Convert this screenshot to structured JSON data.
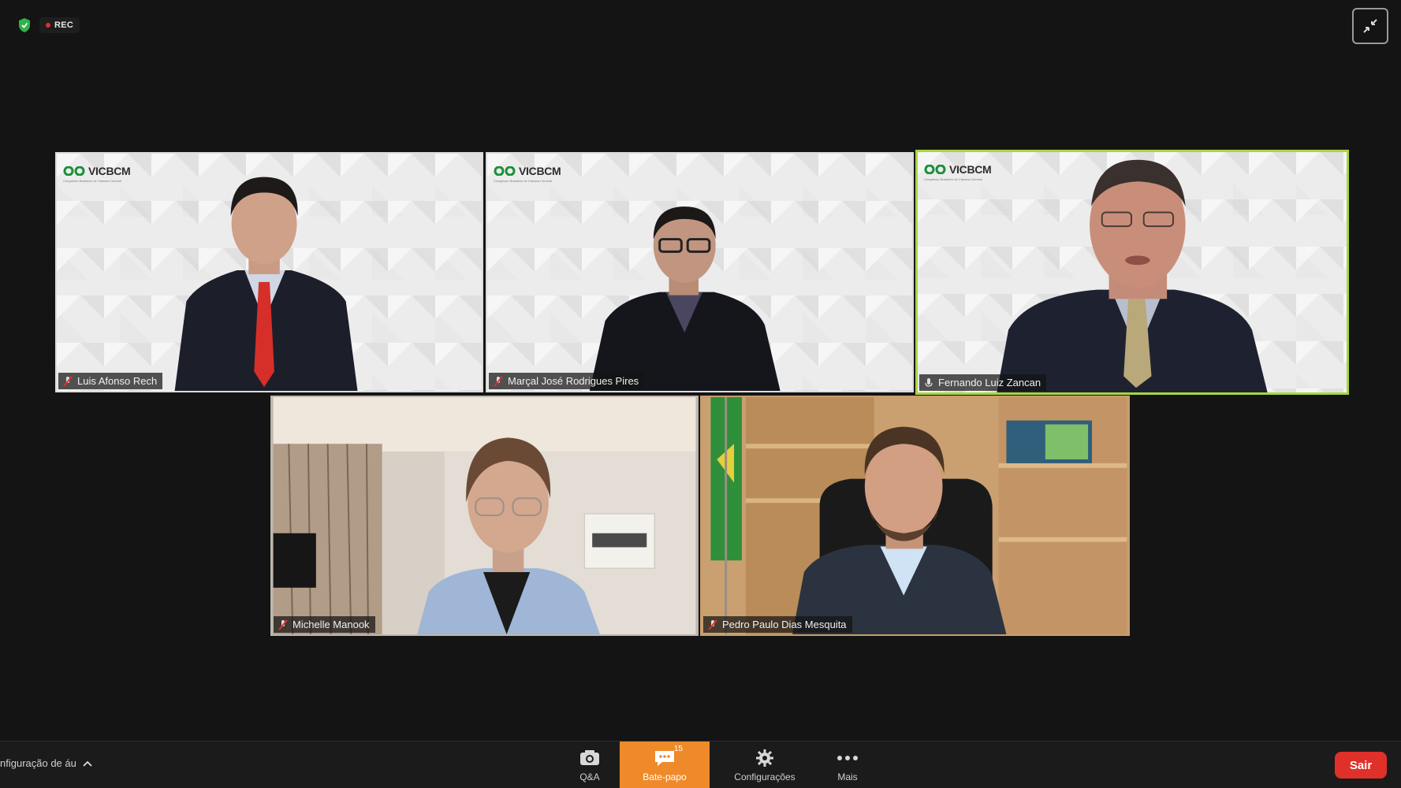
{
  "status": {
    "rec_label": "REC"
  },
  "participants": [
    {
      "name": "Luis Afonso Rech",
      "logo": "VICBCM",
      "logo_sub": "Congresso Brasileiro de Câmara Criminal"
    },
    {
      "name": "Marçal José Rodrigues Pires",
      "logo": "VICBCM",
      "logo_sub": "Congresso Brasileiro de Câmara Criminal"
    },
    {
      "name": "Fernando Luiz Zancan",
      "logo": "VICBCM",
      "logo_sub": "Congresso Brasileiro de Câmara Criminal"
    },
    {
      "name": "Michelle Manook"
    },
    {
      "name": "Pedro Paulo Dias Mesquita"
    }
  ],
  "toolbar": {
    "audio_setting_label": "nfiguração de áu",
    "qa_label": "Q&A",
    "chat_label": "Bate-papo",
    "chat_badge": "15",
    "settings_label": "Configurações",
    "more_label": "Mais",
    "leave_label": "Sair"
  },
  "colors": {
    "active_speaker_border": "#a7d642",
    "chat_button": "#ef8a2a",
    "leave_button": "#e0302a"
  }
}
